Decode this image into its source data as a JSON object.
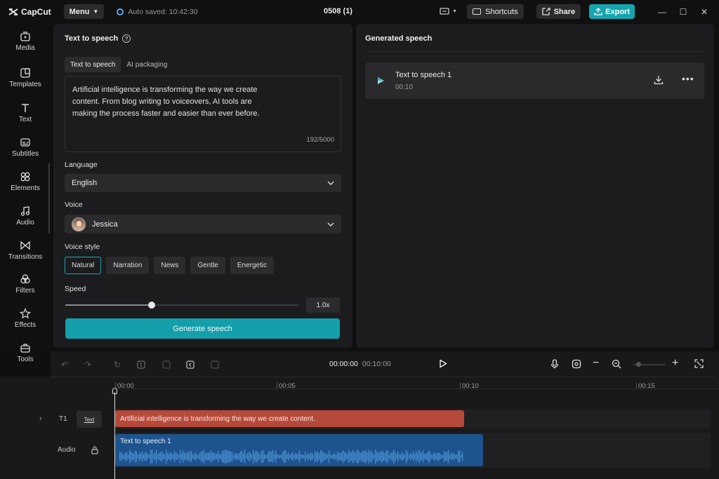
{
  "app": {
    "name": "CapCut",
    "menu_label": "Menu",
    "autosave": "Auto saved: 10:42:30",
    "project_title": "0508 (1)",
    "shortcuts_label": "Shortcuts",
    "share_label": "Share",
    "export_label": "Export",
    "accent_color": "#14a6b0"
  },
  "sidebar": {
    "items": [
      {
        "label": "Media",
        "icon": "media-icon"
      },
      {
        "label": "Templates",
        "icon": "templates-icon"
      },
      {
        "label": "Text",
        "icon": "text-icon"
      },
      {
        "label": "Subtitles",
        "icon": "subtitles-icon"
      },
      {
        "label": "Elements",
        "icon": "elements-icon"
      },
      {
        "label": "Audio",
        "icon": "audio-icon"
      },
      {
        "label": "Transitions",
        "icon": "transitions-icon"
      },
      {
        "label": "Filters",
        "icon": "filters-icon"
      },
      {
        "label": "Effects",
        "icon": "effects-icon"
      },
      {
        "label": "Tools",
        "icon": "tools-icon"
      }
    ]
  },
  "tts": {
    "title": "Text to speech",
    "tabs": [
      "Text to speech",
      "AI packaging"
    ],
    "text": "Artificial intelligence is transforming the way we create content. From blog writing to voiceovers, AI tools are making the process faster and easier than ever before.",
    "char_count": "192/5000",
    "language_label": "Language",
    "language_value": "English",
    "voice_label": "Voice",
    "voice_value": "Jessica",
    "voice_style_label": "Voice style",
    "voice_styles": [
      "Natural",
      "Narration",
      "News",
      "Gentle",
      "Energetic"
    ],
    "selected_style": "Natural",
    "speed_label": "Speed",
    "speed_value": "1.0x",
    "speed_fraction": 0.37,
    "generate_label": "Generate speech"
  },
  "generated": {
    "title": "Generated speech",
    "items": [
      {
        "name": "Text to speech 1",
        "duration": "00:10"
      }
    ]
  },
  "timeline": {
    "current_time": "00:00:00",
    "total_time": "00:10:00",
    "ruler": [
      "00:00",
      "00:05",
      "00:10",
      "00:15"
    ],
    "text_track_label": "T1",
    "text_track_badge": "Text",
    "text_clip": "Artificial intelligence is transforming the way we create content.",
    "audio_track_label": "Audio",
    "audio_clip": "Text to speech 1"
  }
}
